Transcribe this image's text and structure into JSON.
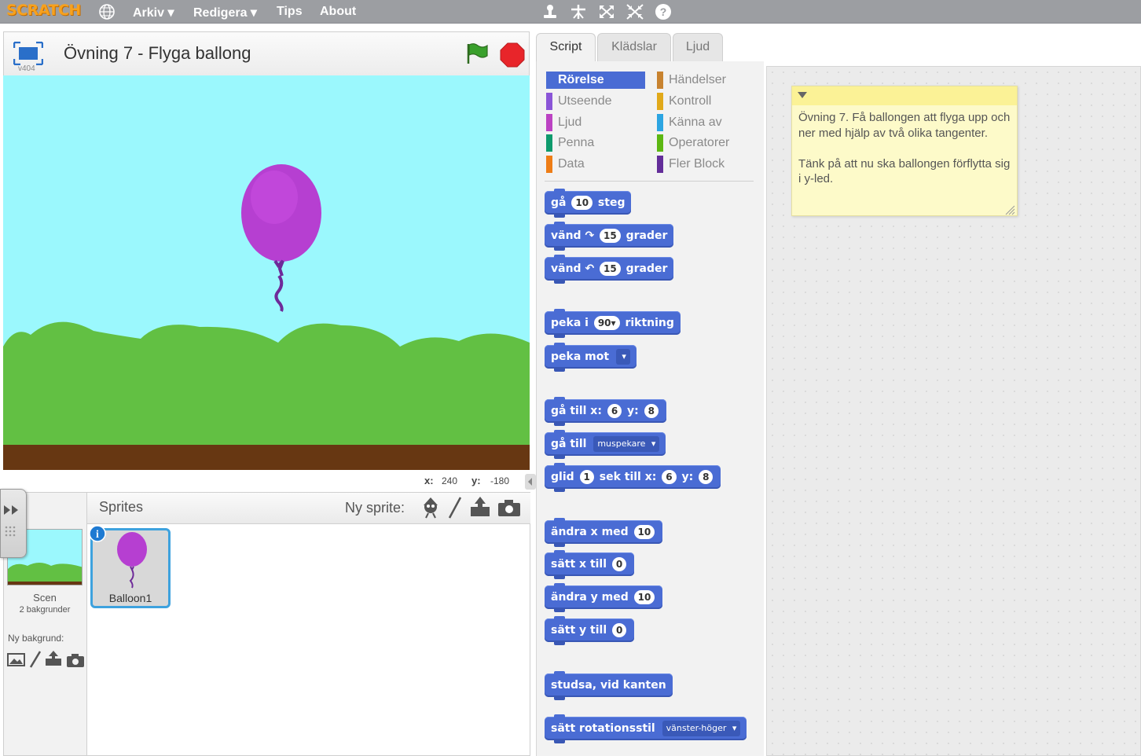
{
  "menubar": {
    "logo": "SCRATCH",
    "items": [
      "Arkiv ▾",
      "Redigera ▾",
      "Tips",
      "About"
    ]
  },
  "stage": {
    "title": "Övning 7 - Flyga ballong",
    "version": "v404",
    "x_label": "x:",
    "x_value": "240",
    "y_label": "y:",
    "y_value": "-180"
  },
  "sprites": {
    "header": "Sprites",
    "new_sprite": "Ny sprite:",
    "items": [
      {
        "name": "Balloon1"
      }
    ],
    "scene_label": "Scen",
    "scene_sub": "2 bakgrunder",
    "new_backdrop": "Ny bakgrund:"
  },
  "tabs": [
    "Script",
    "Klädslar",
    "Ljud"
  ],
  "categories": {
    "left": [
      "Rörelse",
      "Utseende",
      "Ljud",
      "Penna",
      "Data"
    ],
    "right": [
      "Händelser",
      "Kontroll",
      "Känna av",
      "Operatorer",
      "Fler Block"
    ]
  },
  "colors": {
    "motion": "#4a6cd4",
    "looks": "#8a55d7",
    "sound": "#bb42c3",
    "pen": "#0e9a6c",
    "data": "#ee7d16",
    "events": "#c88330",
    "control": "#e1a91a",
    "sensing": "#2ca5e2",
    "operators": "#5cb712",
    "more": "#632d99"
  },
  "blocks": {
    "b1": {
      "a": "gå",
      "n": "10",
      "b": "steg"
    },
    "b2": {
      "a": "vänd",
      "n": "15",
      "b": "grader"
    },
    "b3": {
      "a": "vänd",
      "n": "15",
      "b": "grader"
    },
    "b4": {
      "a": "peka i",
      "n": "90",
      "b": "riktning"
    },
    "b5": {
      "a": "peka mot"
    },
    "b6": {
      "a": "gå till x:",
      "x": "6",
      "ya": "y:",
      "y": "8"
    },
    "b7": {
      "a": "gå till",
      "dd": "muspekare"
    },
    "b8": {
      "a": "glid",
      "n": "1",
      "b": "sek till x:",
      "x": "6",
      "ya": "y:",
      "y": "8"
    },
    "b9": {
      "a": "ändra x med",
      "n": "10"
    },
    "b10": {
      "a": "sätt x till",
      "n": "0"
    },
    "b11": {
      "a": "ändra y med",
      "n": "10"
    },
    "b12": {
      "a": "sätt y till",
      "n": "0"
    },
    "b13": {
      "a": "studsa, vid kanten"
    },
    "b14": {
      "a": "sätt rotationsstil",
      "dd": "vänster-höger"
    }
  },
  "note": {
    "text": "Övning 7. Få ballongen att flyga upp och ner med hjälp av två olika tangenter.\n\nTänk på att nu ska ballongen förflytta sig i y-led."
  }
}
